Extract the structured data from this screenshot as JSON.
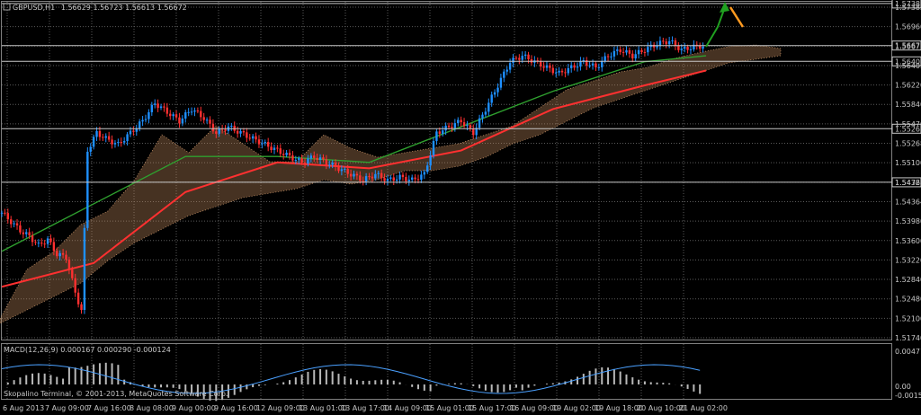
{
  "header": {
    "symbol": "GBPUSD,H1",
    "quote": "1.56629 1.56723 1.56613 1.56672"
  },
  "macd": {
    "label": "MACD(12,26,9) 0.000167 0.000290 -0.000124",
    "y_labels": [
      "0.004716",
      "0.00",
      "-0.001538"
    ]
  },
  "copyright": "Skopalino Terminal, © 2001-2013, MetaQuotes Software Corp.",
  "chart_data": {
    "type": "candlestick",
    "symbol": "GBPUSD",
    "timeframe": "H1",
    "y_ticks": [
      "1.57382",
      "1.56960",
      "1.56672",
      "1.56405",
      "1.56220",
      "1.55840",
      "1.55470",
      "1.55268",
      "1.55100",
      "1.54720",
      "1.54364",
      "1.53980",
      "1.53600",
      "1.53220",
      "1.52840",
      "1.52480",
      "1.52100",
      "1.51740"
    ],
    "x_ticks": [
      "6 Aug 2013",
      "7 Aug 09:00",
      "7 Aug 16:00",
      "8 Aug 08:00",
      "9 Aug 00:00",
      "9 Aug 16:00",
      "12 Aug 09:00",
      "13 Aug 01:00",
      "13 Aug 17:00",
      "14 Aug 09:00",
      "15 Aug 01:00",
      "15 Aug 17:00",
      "16 Aug 09:00",
      "19 Aug 02:00",
      "19 Aug 18:00",
      "20 Aug 10:00",
      "21 Aug 02:00"
    ],
    "ylim": [
      1.5174,
      1.5738
    ],
    "horizontal_levels": [
      1.57382,
      1.56672,
      1.56405,
      1.55268,
      1.54364
    ],
    "close_path": [
      [
        0,
        1.5385
      ],
      [
        3,
        1.537
      ],
      [
        6,
        1.5355
      ],
      [
        9,
        1.5345
      ],
      [
        12,
        1.533
      ],
      [
        15,
        1.534
      ],
      [
        18,
        1.5315
      ],
      [
        21,
        1.531
      ],
      [
        24,
        1.525
      ],
      [
        26,
        1.522
      ],
      [
        28,
        1.549
      ],
      [
        31,
        1.552
      ],
      [
        34,
        1.551
      ],
      [
        38,
        1.55
      ],
      [
        42,
        1.552
      ],
      [
        46,
        1.554
      ],
      [
        50,
        1.557
      ],
      [
        54,
        1.5555
      ],
      [
        58,
        1.554
      ],
      [
        62,
        1.556
      ],
      [
        66,
        1.5545
      ],
      [
        70,
        1.552
      ],
      [
        74,
        1.553
      ],
      [
        78,
        1.552
      ],
      [
        82,
        1.551
      ],
      [
        86,
        1.55
      ],
      [
        90,
        1.549
      ],
      [
        94,
        1.548
      ],
      [
        98,
        1.547
      ],
      [
        102,
        1.548
      ],
      [
        106,
        1.547
      ],
      [
        110,
        1.546
      ],
      [
        114,
        1.545
      ],
      [
        118,
        1.544
      ],
      [
        122,
        1.545
      ],
      [
        126,
        1.544
      ],
      [
        130,
        1.5445
      ],
      [
        134,
        1.544
      ],
      [
        138,
        1.545
      ],
      [
        142,
        1.552
      ],
      [
        146,
        1.553
      ],
      [
        150,
        1.554
      ],
      [
        154,
        1.552
      ],
      [
        158,
        1.556
      ],
      [
        162,
        1.56
      ],
      [
        166,
        1.564
      ],
      [
        170,
        1.565
      ],
      [
        174,
        1.564
      ],
      [
        178,
        1.563
      ],
      [
        182,
        1.562
      ],
      [
        186,
        1.563
      ],
      [
        190,
        1.564
      ],
      [
        194,
        1.563
      ],
      [
        198,
        1.565
      ],
      [
        202,
        1.566
      ],
      [
        206,
        1.565
      ],
      [
        210,
        1.566
      ],
      [
        214,
        1.567
      ],
      [
        218,
        1.5675
      ],
      [
        222,
        1.566
      ],
      [
        226,
        1.5665
      ],
      [
        230,
        1.5667
      ]
    ],
    "ma_red": [
      [
        0,
        1.526
      ],
      [
        30,
        1.53
      ],
      [
        60,
        1.542
      ],
      [
        90,
        1.547
      ],
      [
        120,
        1.546
      ],
      [
        150,
        1.549
      ],
      [
        180,
        1.556
      ],
      [
        210,
        1.56
      ],
      [
        230,
        1.5625
      ]
    ],
    "ma_green": [
      [
        0,
        1.532
      ],
      [
        30,
        1.54
      ],
      [
        60,
        1.548
      ],
      [
        90,
        1.548
      ],
      [
        120,
        1.547
      ],
      [
        150,
        1.553
      ],
      [
        180,
        1.559
      ],
      [
        210,
        1.564
      ],
      [
        230,
        1.565
      ]
    ]
  }
}
